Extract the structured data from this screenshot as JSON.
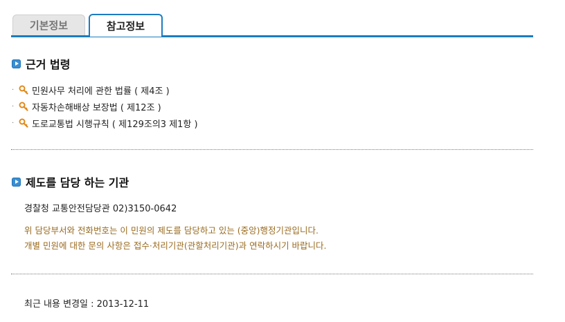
{
  "tabs": [
    {
      "label": "기본정보",
      "active": false
    },
    {
      "label": "참고정보",
      "active": true
    }
  ],
  "legal_basis": {
    "title": "근거 법령",
    "items": [
      {
        "text": "민원사무 처리에 관한 법률 ( 제4조 )",
        "icon": "key-icon"
      },
      {
        "text": "자동차손해배상 보장법 ( 제12조 )",
        "icon": "key-icon"
      },
      {
        "text": "도로교통법 시행규칙 ( 제129조의3 제1항 )",
        "icon": "key-icon"
      }
    ]
  },
  "agency": {
    "title": "제도를 담당 하는 기관",
    "contact": "경찰청 교통안전담당관 02)3150-0642",
    "note_line1": "위 담당부서와 전화번호는 이 민원의 제도를 담당하고 있는 (중앙)행정기관입니다.",
    "note_line2": "개별 민원에 대한 문의 사항은 접수·처리기관(관할처리기관)과 연락하시기 바랍니다."
  },
  "last_updated": "최근 내용 변경일 : 2013-12-11",
  "colors": {
    "accent": "#1a7cc1",
    "note_text": "#9a6b1f",
    "key_icon": "#e08a1a"
  }
}
